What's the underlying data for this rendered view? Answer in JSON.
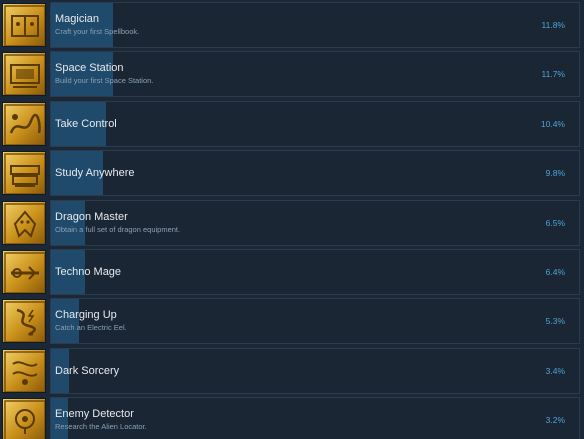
{
  "achievements": [
    {
      "title": "Magician",
      "description": "Craft your first Spellbook.",
      "percent_label": "11.8%",
      "percent": 11.8,
      "icon": "spellbook-icon"
    },
    {
      "title": "Space Station",
      "description": "Build your first Space Station.",
      "percent_label": "11.7%",
      "percent": 11.7,
      "icon": "space-station-icon"
    },
    {
      "title": "Take Control",
      "description": "",
      "percent_label": "10.4%",
      "percent": 10.4,
      "icon": "dragon-coil-icon"
    },
    {
      "title": "Study Anywhere",
      "description": "",
      "percent_label": "9.8%",
      "percent": 9.8,
      "icon": "portable-desk-icon"
    },
    {
      "title": "Dragon Master",
      "description": "Obtain a full set of dragon equipment.",
      "percent_label": "6.5%",
      "percent": 6.5,
      "icon": "dragon-icon"
    },
    {
      "title": "Techno Mage",
      "description": "",
      "percent_label": "6.4%",
      "percent": 6.4,
      "icon": "techno-staff-icon"
    },
    {
      "title": "Charging Up",
      "description": "Catch an Electric Eel.",
      "percent_label": "5.3%",
      "percent": 5.3,
      "icon": "electric-eel-icon"
    },
    {
      "title": "Dark Sorcery",
      "description": "",
      "percent_label": "3.4%",
      "percent": 3.4,
      "icon": "dark-sorcery-icon"
    },
    {
      "title": "Enemy Detector",
      "description": "Research the Alien Locator.",
      "percent_label": "3.2%",
      "percent": 3.2,
      "icon": "alien-locator-icon"
    }
  ],
  "colors": {
    "background": "#1b2838",
    "row_bg": "#1a2634",
    "progress_fill": "#1f4a6b",
    "title_text": "#e6eaee",
    "desc_text": "#8aa1b4",
    "percent_text": "#4fa3d8",
    "icon_gold": "#d9a52a"
  }
}
